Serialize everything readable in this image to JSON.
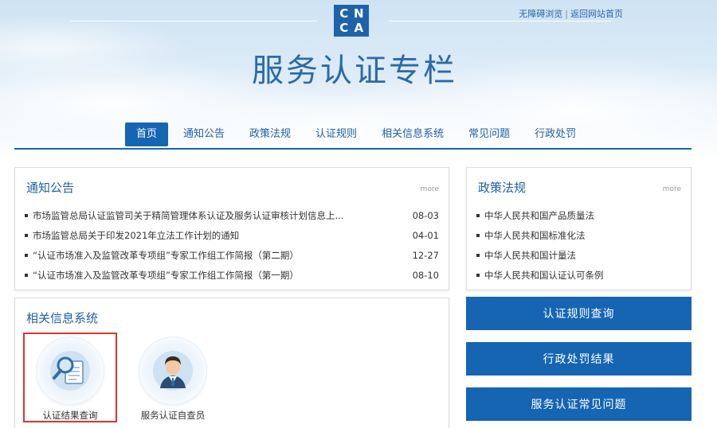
{
  "header": {
    "logo_letters": [
      "C",
      "N",
      "C",
      "A"
    ],
    "top_links": [
      "无障碍浏览",
      "返回网站首页"
    ],
    "site_title": "服务认证专栏"
  },
  "nav": {
    "items": [
      "首页",
      "通知公告",
      "政策法规",
      "认证规则",
      "相关信息系统",
      "常见问题",
      "行政处罚"
    ],
    "active_index": 0
  },
  "notices": {
    "title": "通知公告",
    "more": "more",
    "items": [
      {
        "text": "市场监管总局认证监管司关于精简管理体系认证及服务认证审核计划信息上...",
        "date": "08-03"
      },
      {
        "text": "市场监管总局关于印发2021年立法工作计划的通知",
        "date": "04-01"
      },
      {
        "text": "“认证市场准入及监管改革专项组”专家工作组工作简报（第二期）",
        "date": "12-27"
      },
      {
        "text": "“认证市场准入及监管改革专项组”专家工作组工作简报（第一期）",
        "date": "08-10"
      }
    ]
  },
  "policies": {
    "title": "政策法规",
    "more": "more",
    "items": [
      "中华人民共和国产品质量法",
      "中华人民共和国标准化法",
      "中华人民共和国计量法",
      "中华人民共和国认证认可条例"
    ]
  },
  "systems": {
    "title": "相关信息系统",
    "items": [
      {
        "label": "认证结果查询",
        "icon": "magnifier-document-icon"
      },
      {
        "label": "服务认证自查员",
        "icon": "person-avatar-icon"
      }
    ]
  },
  "buttons": [
    "认证规则查询",
    "行政处罚结果",
    "服务认证常见问题"
  ],
  "colors": {
    "brand": "#1565b3",
    "highlight": "#e0332b"
  }
}
